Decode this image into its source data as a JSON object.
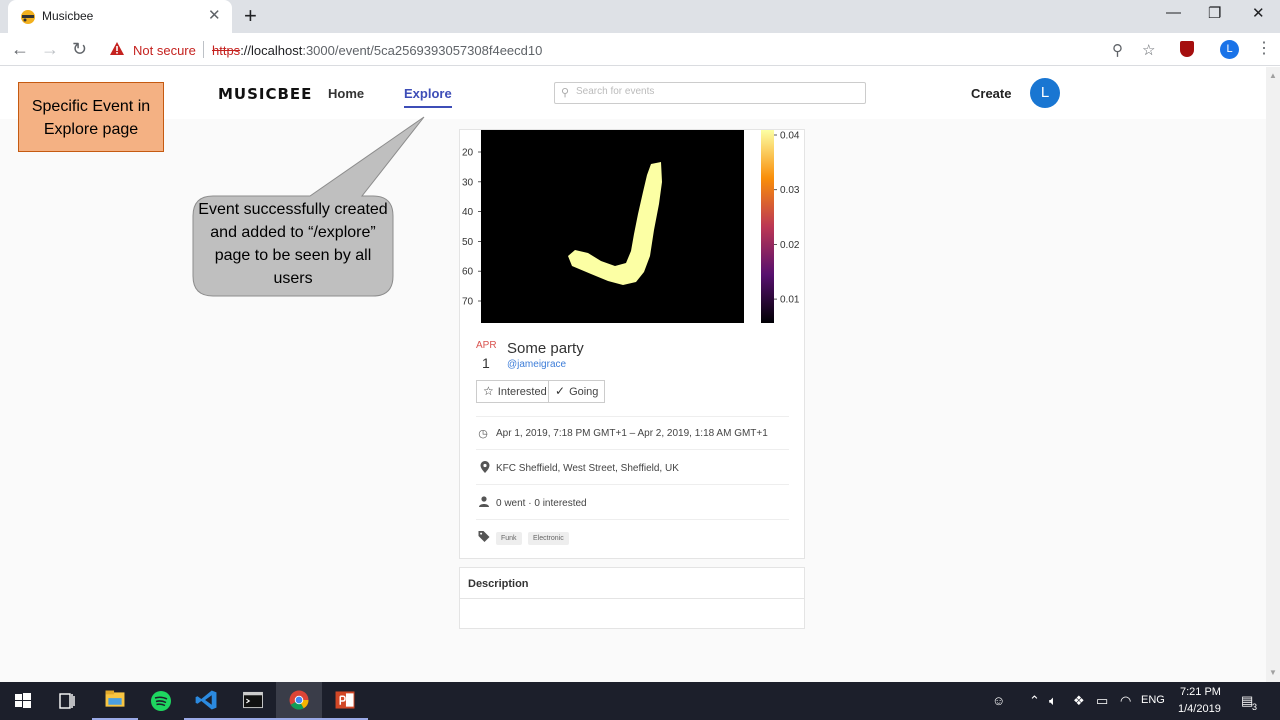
{
  "browser": {
    "tab_title": "Musicbee",
    "security_label": "Not secure",
    "url_scheme": "https",
    "url_host": "://localhost",
    "url_rest": ":3000/event/5ca2569393057308f4eecd10",
    "profile_initial": "L"
  },
  "site": {
    "brand": "MUSICBEE",
    "nav": {
      "home": "Home",
      "explore": "Explore",
      "create": "Create"
    },
    "search_placeholder": "Search for events",
    "avatar_initial": "L"
  },
  "annotations": {
    "box_text": "Specific Event in Explore page",
    "speech_text": "Event successfully created and added to “/explore” page to be seen by all users"
  },
  "figure": {
    "y_ticks": [
      "20",
      "30",
      "40",
      "50",
      "60",
      "70"
    ],
    "colorbar_ticks": [
      "0.04",
      "0.03",
      "0.02",
      "0.01"
    ]
  },
  "event": {
    "month": "APR",
    "day": "1",
    "title": "Some party",
    "host": "@jameigrace",
    "interested_label": "Interested",
    "going_label": "Going",
    "time_range": "Apr 1, 2019, 7:18 PM GMT+1 – Apr 2, 2019, 1:18 AM GMT+1",
    "location": "KFC Sheffield, West Street, Sheffield, UK",
    "attendance": "0 went · 0 interested",
    "tags": [
      "Funk",
      "Electronic"
    ],
    "description_label": "Description"
  },
  "taskbar": {
    "language": "ENG",
    "time": "7:21 PM",
    "date": "1/4/2019",
    "notification_count": "3"
  }
}
